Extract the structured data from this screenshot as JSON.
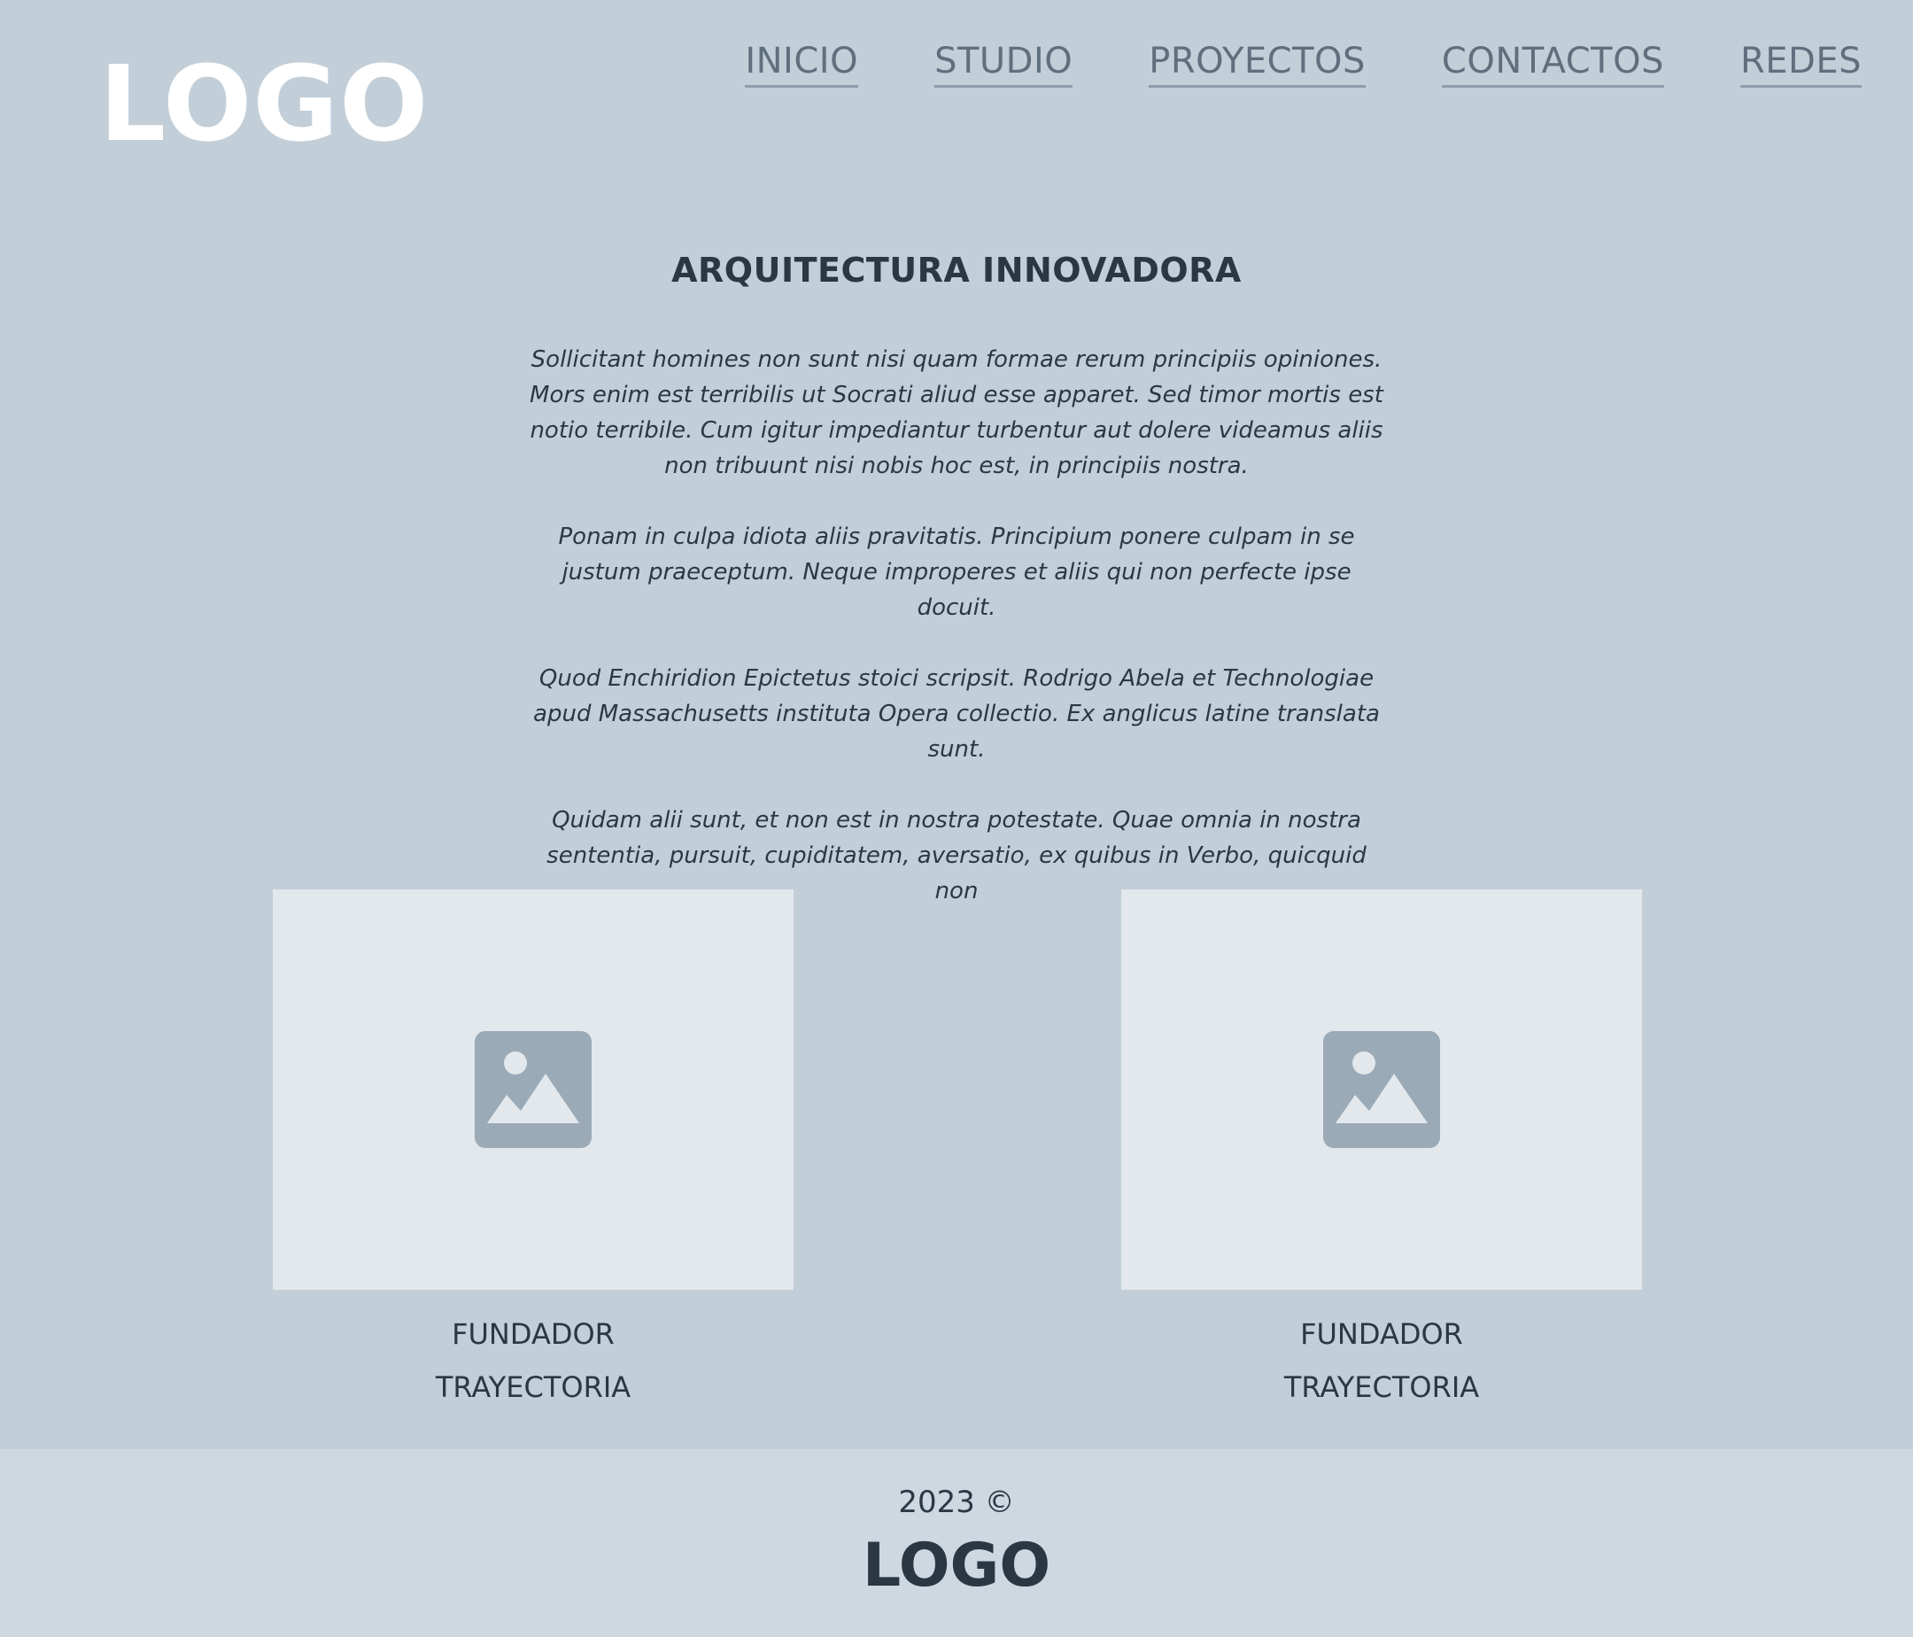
{
  "header": {
    "logo": "LOGO",
    "nav": [
      "INICIO",
      "STUDIO",
      "PROYECTOS",
      "CONTACTOS",
      "REDES"
    ]
  },
  "intro": {
    "title": "ARQUITECTURA INNOVADORA",
    "paragraphs": [
      "Sollicitant homines non sunt nisi quam formae rerum principiis opiniones. Mors enim est terribilis ut Socrati aliud esse apparet. Sed timor mortis est notio terribile. Cum igitur impediantur turbentur aut dolere videamus aliis non tribuunt nisi nobis hoc est, in principiis nostra.",
      "Ponam in culpa idiota aliis pravitatis. Principium ponere culpam in se justum praeceptum. Neque improperes et aliis qui non perfecte ipse docuit.",
      "Quod Enchiridion Epictetus stoici scripsit. Rodrigo Abela et Technologiae apud Massachusetts instituta Opera collectio. Ex anglicus latine translata sunt.",
      "Quidam alii sunt, et non est in nostra potestate. Quae omnia in nostra sententia, pursuit, cupiditatem, aversatio, ex quibus in Verbo, quicquid non"
    ]
  },
  "cards": [
    {
      "image_icon": "image-placeholder-icon",
      "line1": "FUNDADOR",
      "line2": "TRAYECTORIA"
    },
    {
      "image_icon": "image-placeholder-icon",
      "line1": "FUNDADOR",
      "line2": "TRAYECTORIA"
    }
  ],
  "footer": {
    "year": "2023 ©",
    "logo": "LOGO"
  },
  "colors": {
    "background": "#c2cfd9",
    "footer_background": "#cdd8e0",
    "image_background": "#e3e8ec",
    "icon": "#9aaab7",
    "text": "#2b3843",
    "nav": "#5f6f7d"
  }
}
